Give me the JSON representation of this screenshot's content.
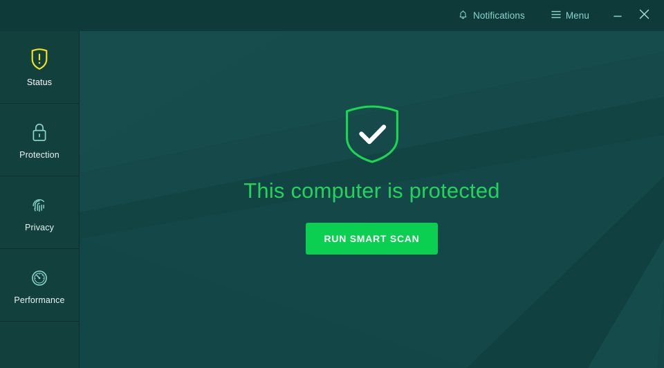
{
  "titlebar": {
    "notifications_label": "Notifications",
    "notifications_icon": "bell-icon",
    "menu_label": "Menu",
    "menu_icon": "hamburger-menu-icon",
    "minimize_icon": "minimize-icon",
    "close_icon": "close-icon"
  },
  "sidebar": {
    "items": [
      {
        "label": "Status",
        "icon": "shield-warning-icon",
        "active": true
      },
      {
        "label": "Protection",
        "icon": "padlock-icon",
        "active": false
      },
      {
        "label": "Privacy",
        "icon": "fingerprint-icon",
        "active": false
      },
      {
        "label": "Performance",
        "icon": "speedometer-icon",
        "active": false
      }
    ]
  },
  "main": {
    "status_icon": "shield-check-icon",
    "headline": "This computer is protected",
    "scan_button_label": "RUN SMART SCAN"
  },
  "colors": {
    "titlebar_bg": "#0E3B39",
    "sidebar_bg": "#11403D",
    "main_bg": "#144644",
    "accent_green": "#0ACF50",
    "headline_green": "#24D35B",
    "warning_yellow": "#F2E21C",
    "icon_teal": "#8CD3CC",
    "text_light": "#E7F4F2"
  }
}
